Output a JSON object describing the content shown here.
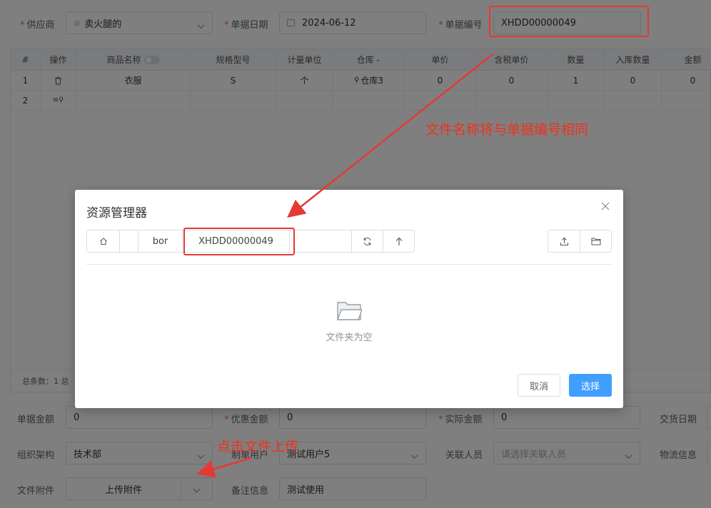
{
  "form": {
    "supplier_label": "供应商",
    "supplier_value": "卖火腿的",
    "date_label": "单据日期",
    "date_value": "2024-06-12",
    "number_label": "单据编号",
    "number_value": "XHDD00000049",
    "amount_label": "单据金额",
    "amount_value": "0",
    "discount_label": "优惠金额",
    "discount_value": "0",
    "actual_label": "实际金额",
    "actual_value": "0",
    "delivery_label": "交货日期",
    "org_label": "组织架构",
    "org_value": "技术部",
    "maker_label": "制单用户",
    "maker_value": "测试用户5",
    "related_label": "关联人员",
    "related_placeholder": "请选择关联人员",
    "logistics_label": "物流信息",
    "attach_label": "文件附件",
    "attach_button": "上传附件",
    "remark_label": "备注信息",
    "remark_value": "测试使用"
  },
  "table": {
    "headers": [
      "#",
      "操作",
      "商品名称",
      "规格型号",
      "计量单位",
      "仓库",
      "单价",
      "含税单价",
      "数量",
      "入库数量",
      "金额"
    ],
    "rows": [
      {
        "index": "1",
        "name": "衣服",
        "spec": "S",
        "unit": "个",
        "warehouse": "仓库3",
        "price": "0",
        "tax_price": "0",
        "qty": "1",
        "in_qty": "0",
        "amount": "0"
      },
      {
        "index": "2"
      }
    ],
    "footer": "总条数：1   总"
  },
  "dialog": {
    "title": "资源管理器",
    "crumb_folder": "bor",
    "crumb_current": "XHDD00000049",
    "empty_text": "文件夹为空",
    "cancel_label": "取消",
    "select_label": "选择"
  },
  "annotations": {
    "filename_note": "文件名称将与单据编号相同",
    "upload_note": "点击文件上传"
  },
  "colors": {
    "annotation_red": "#e53935",
    "primary_blue": "#409eff"
  }
}
